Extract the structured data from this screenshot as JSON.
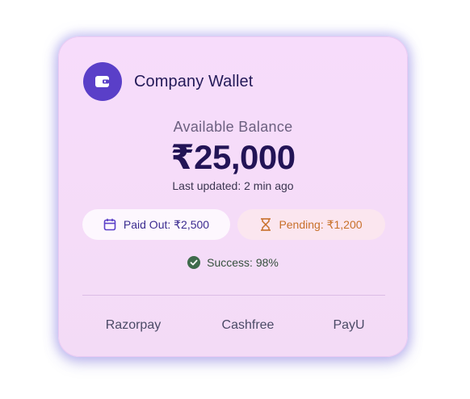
{
  "wallet": {
    "title": "Company Wallet",
    "icon": "wallet-icon"
  },
  "balance": {
    "label": "Available Balance",
    "amount": "₹25,000",
    "updated": "Last updated: 2 min ago"
  },
  "stats": {
    "paid_out": "Paid Out: ₹2,500",
    "paid_out_icon": "calendar-icon",
    "pending": "Pending: ₹1,200",
    "pending_icon": "hourglass-icon",
    "success": "Success: 98%",
    "success_icon": "check-circle-icon"
  },
  "providers": [
    "Razorpay",
    "Cashfree",
    "PayU"
  ],
  "colors": {
    "accent": "#5a3fc8",
    "card_bg": "#f7dcfb",
    "pending": "#c8702a",
    "success": "#3f6b4c",
    "glow": "#968ceb"
  }
}
